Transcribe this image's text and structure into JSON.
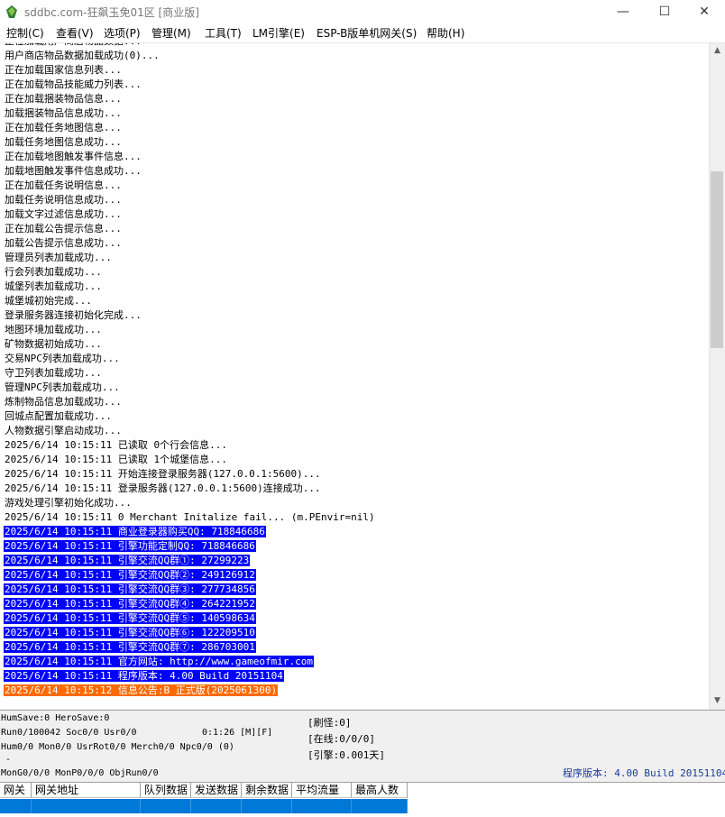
{
  "window": {
    "title": "sddbc.com-狂飙玉免01区 [商业版]",
    "minimize_icon": "minimize-icon",
    "maximize_icon": "maximize-icon",
    "close_icon": "close-icon",
    "minimize_glyph": "—",
    "maximize_glyph": "☐",
    "close_glyph": "✕"
  },
  "menu": [
    "控制(C)",
    "查看(V)",
    "选项(P)",
    "管理(M)",
    "工具(T)",
    "LM引擎(E)",
    "ESP-B版单机网关(S)",
    "帮助(H)"
  ],
  "log": {
    "lines": [
      {
        "text": "正在加载用户商店物品数据...",
        "style": "normal"
      },
      {
        "text": "用户商店物品数据加载成功(0)...",
        "style": "normal"
      },
      {
        "text": "正在加载国家信息列表...",
        "style": "normal"
      },
      {
        "text": "正在加载物品技能威力列表...",
        "style": "normal"
      },
      {
        "text": "正在加载捆装物品信息...",
        "style": "normal"
      },
      {
        "text": "加载捆装物品信息成功...",
        "style": "normal"
      },
      {
        "text": "正在加载任务地图信息...",
        "style": "normal"
      },
      {
        "text": "加载任务地图信息成功...",
        "style": "normal"
      },
      {
        "text": "正在加载地图触发事件信息...",
        "style": "normal"
      },
      {
        "text": "加载地图触发事件信息成功...",
        "style": "normal"
      },
      {
        "text": "正在加载任务说明信息...",
        "style": "normal"
      },
      {
        "text": "加载任务说明信息成功...",
        "style": "normal"
      },
      {
        "text": "加载文字过滤信息成功...",
        "style": "normal"
      },
      {
        "text": "正在加载公告提示信息...",
        "style": "normal"
      },
      {
        "text": "加载公告提示信息成功...",
        "style": "normal"
      },
      {
        "text": "管理员列表加载成功...",
        "style": "normal"
      },
      {
        "text": "行会列表加载成功...",
        "style": "normal"
      },
      {
        "text": "城堡列表加载成功...",
        "style": "normal"
      },
      {
        "text": "城堡城初始完成...",
        "style": "normal"
      },
      {
        "text": "登录服务器连接初始化完成...",
        "style": "normal"
      },
      {
        "text": "地图环境加载成功...",
        "style": "normal"
      },
      {
        "text": "矿物数据初始成功...",
        "style": "normal"
      },
      {
        "text": "交易NPC列表加载成功...",
        "style": "normal"
      },
      {
        "text": "守卫列表加载成功...",
        "style": "normal"
      },
      {
        "text": "管理NPC列表加载成功...",
        "style": "normal"
      },
      {
        "text": "炼制物品信息加载成功...",
        "style": "normal"
      },
      {
        "text": "回城点配置加载成功...",
        "style": "normal"
      },
      {
        "text": "人物数据引擎启动成功...",
        "style": "normal"
      },
      {
        "text": "2025/6/14 10:15:11 已读取 0个行会信息...",
        "style": "normal"
      },
      {
        "text": "2025/6/14 10:15:11 已读取 1个城堡信息...",
        "style": "normal"
      },
      {
        "text": "2025/6/14 10:15:11 开始连接登录服务器(127.0.0.1:5600)...",
        "style": "normal"
      },
      {
        "text": "2025/6/14 10:15:11 登录服务器(127.0.0.1:5600)连接成功...",
        "style": "normal"
      },
      {
        "text": "游戏处理引擎初始化成功...",
        "style": "normal"
      },
      {
        "text": "2025/6/14 10:15:11 0 Merchant Initalize fail... (m.PEnvir=nil)",
        "style": "normal"
      },
      {
        "text": "2025/6/14 10:15:11 商业登录器购买QQ: 718846686",
        "style": "blue"
      },
      {
        "text": "2025/6/14 10:15:11 引擎功能定制QQ: 718846686",
        "style": "blue"
      },
      {
        "text": "2025/6/14 10:15:11 引擎交流QQ群①: 27299223",
        "style": "blue"
      },
      {
        "text": "2025/6/14 10:15:11 引擎交流QQ群②: 249126912",
        "style": "blue"
      },
      {
        "text": "2025/6/14 10:15:11 引擎交流QQ群③: 277734856",
        "style": "blue"
      },
      {
        "text": "2025/6/14 10:15:11 引擎交流QQ群④: 264221952",
        "style": "blue"
      },
      {
        "text": "2025/6/14 10:15:11 引擎交流QQ群⑤: 140598634",
        "style": "blue"
      },
      {
        "text": "2025/6/14 10:15:11 引擎交流QQ群⑥: 122209510",
        "style": "blue"
      },
      {
        "text": "2025/6/14 10:15:11 引擎交流QQ群⑦: 286703001",
        "style": "blue"
      },
      {
        "text": "2025/6/14 10:15:11 官方网站: http://www.gameofmir.com",
        "style": "blue"
      },
      {
        "text": "2025/6/14 10:15:11 程序版本: 4.00 Build 20151104",
        "style": "blue"
      },
      {
        "text": "2025/6/14 10:15:12 信息公告:B 正式版(2025061300)",
        "style": "orange"
      }
    ]
  },
  "scrollbar": {
    "up_icon": "scroll-up-icon",
    "down_icon": "scroll-down-icon",
    "up_glyph": "▲",
    "down_glyph": "▼"
  },
  "status": {
    "line1": "HumSave:0 HeroSave:0",
    "line2": "Run0/100042 Soc0/0 Usr0/0",
    "line2_time": "0:1:26 [M][F]",
    "line3": "Hum0/0 Mon0/0 UsrRot0/0 Merch0/0 Npc0/0 (0)",
    "line4": "-",
    "line5": "MonG0/0/0 MonP0/0/0 ObjRun0/0",
    "refresh": "[刷怪:0]",
    "online": "[在线:0/0/0]",
    "engine": "[引擎:0.001天]",
    "version": "程序版本: 4.00 Build 20151104"
  },
  "gateway_table": {
    "columns": [
      "网关",
      "网关地址",
      "队列数据",
      "发送数据",
      "剩余数据",
      "平均流量",
      "最高人数"
    ]
  },
  "colors": {
    "highlight_blue": "#0000ff",
    "highlight_orange": "#ff6a00",
    "selection": "#0078d7"
  }
}
